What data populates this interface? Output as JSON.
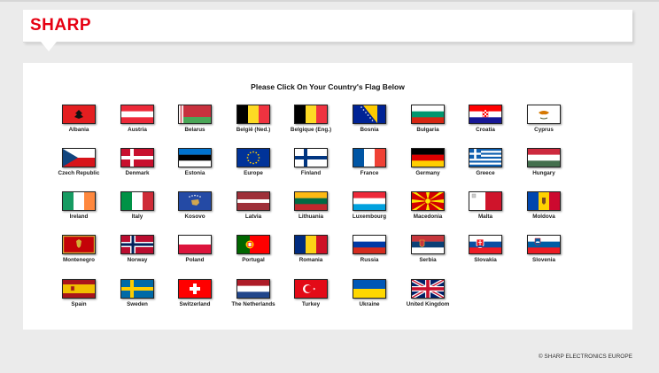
{
  "brand": {
    "logo_text": "SHARP",
    "logo_color": "#e60012"
  },
  "heading": "Please Click On Your Country's Flag Below",
  "countries": [
    {
      "label": "Albania",
      "flag": "albania"
    },
    {
      "label": "Austria",
      "flag": "austria"
    },
    {
      "label": "Belarus",
      "flag": "belarus"
    },
    {
      "label": "België (Ned.)",
      "flag": "belgium"
    },
    {
      "label": "Belgique (Eng.)",
      "flag": "belgium"
    },
    {
      "label": "Bosnia",
      "flag": "bosnia"
    },
    {
      "label": "Bulgaria",
      "flag": "bulgaria"
    },
    {
      "label": "Croatia",
      "flag": "croatia"
    },
    {
      "label": "Cyprus",
      "flag": "cyprus"
    },
    {
      "label": "Czech Republic",
      "flag": "czech"
    },
    {
      "label": "Denmark",
      "flag": "denmark"
    },
    {
      "label": "Estonia",
      "flag": "estonia"
    },
    {
      "label": "Europe",
      "flag": "europe"
    },
    {
      "label": "Finland",
      "flag": "finland"
    },
    {
      "label": "France",
      "flag": "france"
    },
    {
      "label": "Germany",
      "flag": "germany"
    },
    {
      "label": "Greece",
      "flag": "greece"
    },
    {
      "label": "Hungary",
      "flag": "hungary"
    },
    {
      "label": "Ireland",
      "flag": "ireland"
    },
    {
      "label": "Italy",
      "flag": "italy"
    },
    {
      "label": "Kosovo",
      "flag": "kosovo"
    },
    {
      "label": "Latvia",
      "flag": "latvia"
    },
    {
      "label": "Lithuania",
      "flag": "lithuania"
    },
    {
      "label": "Luxembourg",
      "flag": "luxembourg"
    },
    {
      "label": "Macedonia",
      "flag": "macedonia"
    },
    {
      "label": "Malta",
      "flag": "malta"
    },
    {
      "label": "Moldova",
      "flag": "moldova"
    },
    {
      "label": "Montenegro",
      "flag": "montenegro"
    },
    {
      "label": "Norway",
      "flag": "norway"
    },
    {
      "label": "Poland",
      "flag": "poland"
    },
    {
      "label": "Portugal",
      "flag": "portugal"
    },
    {
      "label": "Romania",
      "flag": "romania"
    },
    {
      "label": "Russia",
      "flag": "russia"
    },
    {
      "label": "Serbia",
      "flag": "serbia"
    },
    {
      "label": "Slovakia",
      "flag": "slovakia"
    },
    {
      "label": "Slovenia",
      "flag": "slovenia"
    },
    {
      "label": "Spain",
      "flag": "spain"
    },
    {
      "label": "Sweden",
      "flag": "sweden"
    },
    {
      "label": "Switzerland",
      "flag": "switzerland"
    },
    {
      "label": "The Netherlands",
      "flag": "netherlands"
    },
    {
      "label": "Turkey",
      "flag": "turkey"
    },
    {
      "label": "Ukraine",
      "flag": "ukraine"
    },
    {
      "label": "United Kingdom",
      "flag": "uk"
    }
  ],
  "footer": "© SHARP ELECTRONICS EUROPE"
}
